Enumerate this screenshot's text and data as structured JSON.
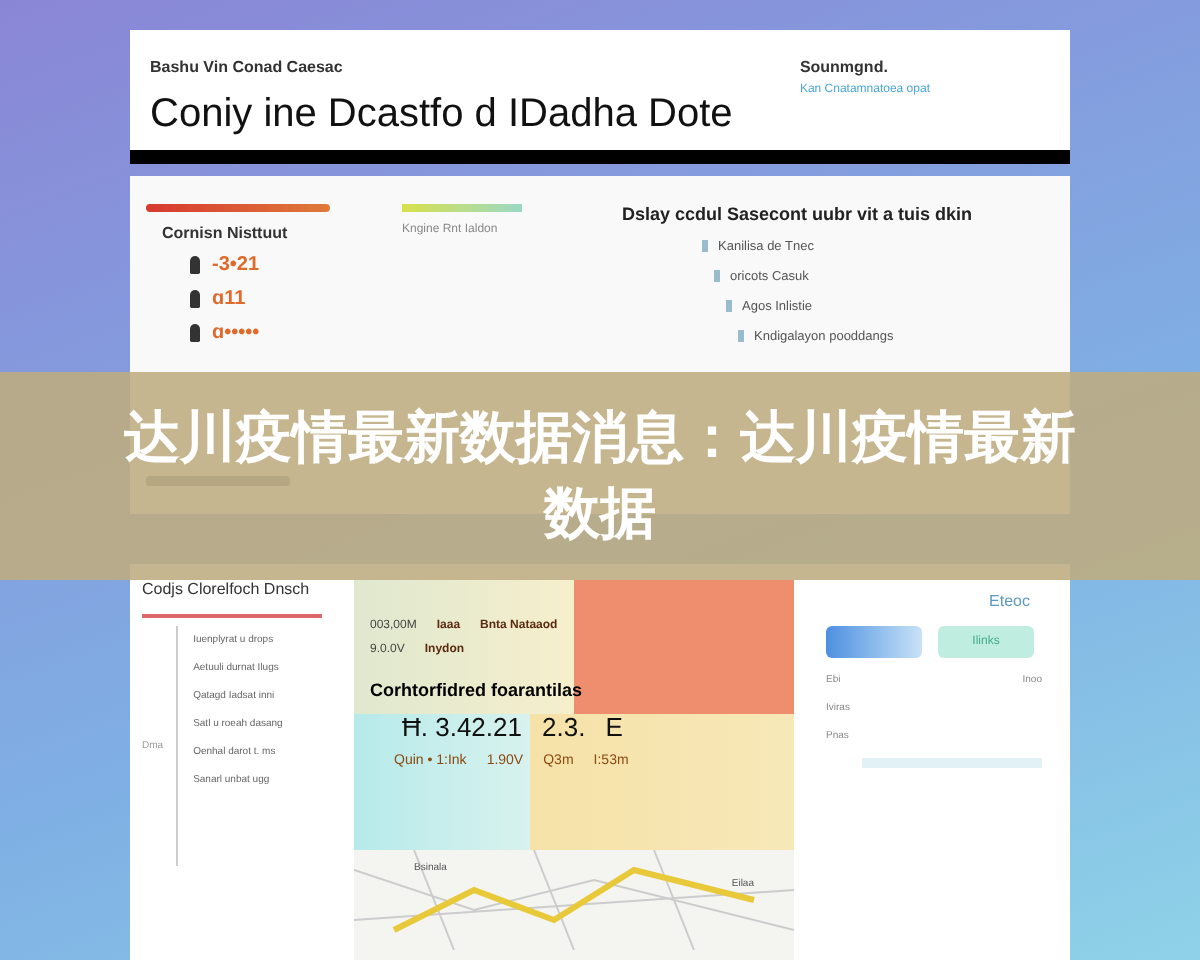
{
  "header": {
    "kicker": "Bashu Vin Conad Caesac",
    "title": "Coniy ine Dcastfo d IDadha Dote",
    "right_label": "Sounmgnd.",
    "right_link": "Kan Cnatamnatoea opat"
  },
  "summary": {
    "left_heading": "Cornisn Nisttuut",
    "stats": [
      "-3•21",
      "ɑ11",
      "ɑ•••••"
    ],
    "mid_caption": "Kngine Rnt Ialdon",
    "right_heading": "Dslay ccdul Sasecont uubr vit a tuis dkin",
    "right_items": [
      "Kanilisa de Tnec",
      "oricots Casuk",
      "Agos Inlistie",
      "Kndigalayon pooddangs"
    ]
  },
  "banner": {
    "text": "达川疫情最新数据消息：达川疫情最新数据"
  },
  "detail": {
    "list_title": "Codjs Clorelfoch Dnsch",
    "list_items": [
      "Iuenplyrat u drops",
      "Aetuuli durnat Ilugs",
      "Qatagd Iadsat inni",
      "Satl u roeah dasang",
      "Oenhal darot t. ms",
      "Sanarl unbat ugg"
    ],
    "side_label": "Dma",
    "grid_top": [
      "003,00M",
      "Iaaa",
      "Bnta Nataaod",
      "9.0.0V",
      "Inydon"
    ],
    "grid_heading": "Corhtorfidred foarantilas",
    "grid_values": [
      "Ħ. 3.42.21",
      "2.3.",
      "E"
    ],
    "grid_row": [
      "Quin • 1:Ink",
      "1.90V",
      "Q3m",
      "I:53m"
    ],
    "map_label": "Bsinala",
    "map_place": "Eilaa",
    "panel_title": "Eteoc",
    "panel_button": "Ilinks",
    "panel_rows": [
      "Ebi",
      "Iviras",
      "Pnas"
    ],
    "panel_right": "Inoo"
  }
}
